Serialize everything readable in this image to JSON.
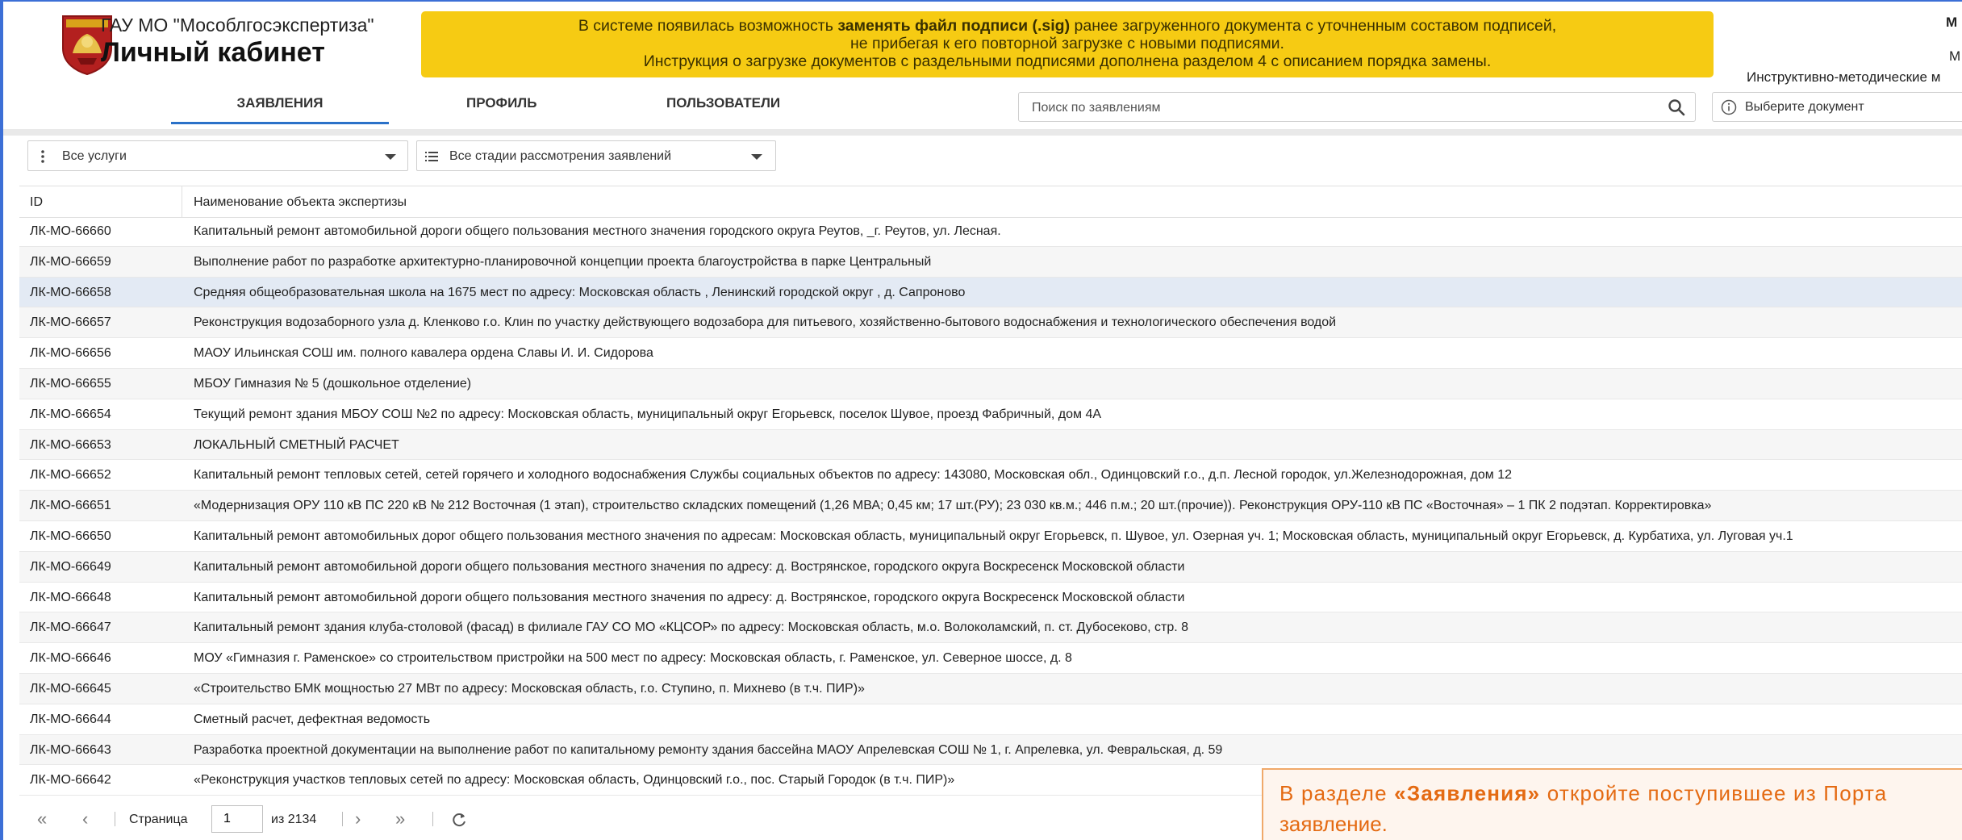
{
  "header": {
    "org_name": "ГАУ МО \"Мособлгосэкспертиза\"",
    "cabinet_title": "Личный кабинет",
    "notice": {
      "line1_before": "В системе появилась возможность ",
      "line1_bold": "заменять файл подписи (.sig)",
      "line1_after": " ранее загруженного документа с уточненным составом подписей,",
      "line2": "не прибегая к его повторной загрузке с новыми подписями.",
      "line3": "Инструкция о загрузке документов с раздельными подписями дополнена разделом 4 с описанием порядка замены."
    },
    "right_cut": {
      "line1": "М",
      "line2": "М",
      "line3": "Инструктивно-методические м"
    },
    "accent_color": "#2a71c8",
    "notice_color": "#f6cb13"
  },
  "nav": {
    "tabs": [
      {
        "label": "ЗАЯВЛЕНИЯ",
        "active": true
      },
      {
        "label": "ПРОФИЛЬ",
        "active": false
      },
      {
        "label": "ПОЛЬЗОВАТЕЛИ",
        "active": false
      }
    ],
    "search_placeholder": "Поиск по заявлениям",
    "doc_select_label": "Выберите документ"
  },
  "filters": {
    "services": "Все услуги",
    "stages": "Все стадии рассмотрения заявлений"
  },
  "table": {
    "columns": [
      "ID",
      "Наименование объекта экспертизы"
    ],
    "rows": [
      {
        "id": "ЛК-МО-66660",
        "name": "Капитальный ремонт автомобильной дороги общего пользования местного значения городского округа Реутов, _г. Реутов, ул. Лесная."
      },
      {
        "id": "ЛК-МО-66659",
        "name": "Выполнение работ по разработке архитектурно-планировочной концепции проекта благоустройства в парке Центральный"
      },
      {
        "id": "ЛК-МО-66658",
        "name": "Средняя общеобразовательная школа на 1675 мест по адресу: Московская область , Ленинский городской округ , д. Сапроново",
        "selected": true
      },
      {
        "id": "ЛК-МО-66657",
        "name": "Реконструкция водозаборного узла д. Кленково г.о. Клин по участку действующего водозабора для питьевого, хозяйственно-бытового водоснабжения и технологического обеспечения водой"
      },
      {
        "id": "ЛК-МО-66656",
        "name": "МАОУ Ильинская СОШ им. полного кавалера ордена Славы И. И. Сидорова"
      },
      {
        "id": "ЛК-МО-66655",
        "name": "МБОУ Гимназия № 5 (дошкольное отделение)"
      },
      {
        "id": "ЛК-МО-66654",
        "name": "Текущий ремонт здания МБОУ СОШ №2 по адресу: Московская область, муниципальный округ Егорьевск, поселок Шувое, проезд Фабричный, дом 4А"
      },
      {
        "id": "ЛК-МО-66653",
        "name": "ЛОКАЛЬНЫЙ СМЕТНЫЙ РАСЧЕТ"
      },
      {
        "id": "ЛК-МО-66652",
        "name": "Капитальный ремонт тепловых сетей, сетей горячего и холодного водоснабжения Службы социальных объектов по адресу: 143080, Московская обл., Одинцовский г.о., д.п. Лесной городок, ул.Железнодорожная, дом 12"
      },
      {
        "id": "ЛК-МО-66651",
        "name": "«Модернизация ОРУ 110 кВ ПС 220 кВ № 212 Восточная (1 этап), строительство складских помещений (1,26 МВА; 0,45 км; 17 шт.(РУ); 23 030 кв.м.; 446 п.м.; 20 шт.(прочие)). Реконструкция ОРУ-110 кВ ПС «Восточная» – 1 ПК 2 подэтап. Корректировка»"
      },
      {
        "id": "ЛК-МО-66650",
        "name": "Капитальный ремонт автомобильных дорог общего пользования местного значения по адресам: Московская область, муниципальный округ Егорьевск, п. Шувое, ул. Озерная уч. 1; Московская область, муниципальный округ Егорьевск, д. Курбатиха, ул. Луговая уч.1"
      },
      {
        "id": "ЛК-МО-66649",
        "name": "Капитальный ремонт автомобильной дороги общего пользования местного значения по адресу: д. Вострянское, городского округа Воскресенск Московской области"
      },
      {
        "id": "ЛК-МО-66648",
        "name": "Капитальный ремонт автомобильной дороги общего пользования местного значения по адресу: д. Вострянское, городского округа Воскресенск Московской области"
      },
      {
        "id": "ЛК-МО-66647",
        "name": "Капитальный ремонт здания клуба-столовой (фасад) в филиале ГАУ СО МО «КЦСОР» по адресу: Московская область, м.о. Волоколамский, п. ст. Дубосеково, стр. 8"
      },
      {
        "id": "ЛК-МО-66646",
        "name": "МОУ «Гимназия г. Раменское» со строительством пристройки на 500 мест по адресу: Московская область, г. Раменское, ул. Северное шоссе, д. 8"
      },
      {
        "id": "ЛК-МО-66645",
        "name": "«Строительство БМК мощностью 27 МВт по адресу: Московская область, г.о. Ступино, п. Михнево (в т.ч. ПИР)»"
      },
      {
        "id": "ЛК-МО-66644",
        "name": "Сметный расчет, дефектная ведомость"
      },
      {
        "id": "ЛК-МО-66643",
        "name": "Разработка проектной документации на выполнение работ по капитальному ремонту здания бассейна МАОУ Апрелевская СОШ № 1, г. Апрелевка, ул. Февральская, д. 59"
      },
      {
        "id": "ЛК-МО-66642",
        "name": "«Реконструкция участков тепловых сетей по адресу: Московская область, Одинцовский г.о., пос. Старый Городок (в т.ч. ПИР)»"
      }
    ]
  },
  "pager": {
    "page_label": "Страница",
    "current_page": "1",
    "total_label": "из 2134"
  },
  "callout": {
    "before": "В разделе ",
    "bold": "«Заявления»",
    "after": " откройте поступившее из Порта",
    "line2": "заявление.",
    "color": "#e46a12"
  }
}
